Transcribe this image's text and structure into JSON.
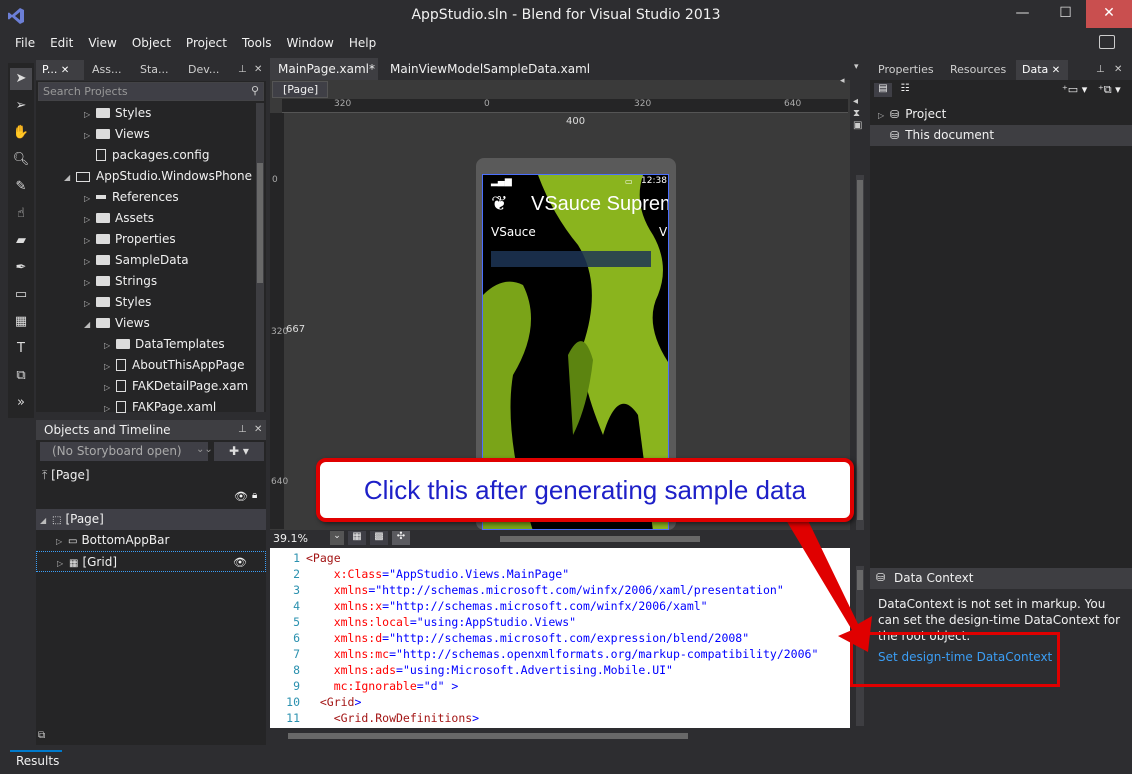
{
  "window": {
    "title": "AppStudio.sln - Blend for Visual Studio 2013",
    "minimize": "—",
    "maximize": "☐",
    "close": "✕"
  },
  "menu": [
    "File",
    "Edit",
    "View",
    "Object",
    "Project",
    "Tools",
    "Window",
    "Help"
  ],
  "tools": [
    "selection-icon",
    "direct-selection-icon",
    "pan-icon",
    "zoom-icon",
    "eyedropper-icon",
    "paint-bucket-icon",
    "eraser-icon",
    "pen-icon",
    "rectangle-icon",
    "grid-icon",
    "text-icon",
    "control-icon",
    "more-tools-icon"
  ],
  "project_panel": {
    "tabs": [
      "P...",
      "Ass...",
      "Sta...",
      "Dev..."
    ],
    "search_placeholder": "Search Projects",
    "tree": [
      {
        "label": "Styles",
        "indent": 1,
        "type": "folder",
        "arrow": "▷"
      },
      {
        "label": "Views",
        "indent": 1,
        "type": "folder",
        "arrow": "▷"
      },
      {
        "label": "packages.config",
        "indent": 1,
        "type": "file",
        "arrow": ""
      },
      {
        "label": "AppStudio.WindowsPhone",
        "indent": 0,
        "type": "project",
        "arrow": "◢"
      },
      {
        "label": "References",
        "indent": 1,
        "type": "ref",
        "arrow": "▷"
      },
      {
        "label": "Assets",
        "indent": 1,
        "type": "folder",
        "arrow": "▷"
      },
      {
        "label": "Properties",
        "indent": 1,
        "type": "folder",
        "arrow": "▷"
      },
      {
        "label": "SampleData",
        "indent": 1,
        "type": "folder",
        "arrow": "▷"
      },
      {
        "label": "Strings",
        "indent": 1,
        "type": "folder",
        "arrow": "▷"
      },
      {
        "label": "Styles",
        "indent": 1,
        "type": "folder",
        "arrow": "▷"
      },
      {
        "label": "Views",
        "indent": 1,
        "type": "folder",
        "arrow": "◢"
      },
      {
        "label": "DataTemplates",
        "indent": 2,
        "type": "folder",
        "arrow": "▷"
      },
      {
        "label": "AboutThisAppPage",
        "indent": 2,
        "type": "file",
        "arrow": "▷"
      },
      {
        "label": "FAKDetailPage.xam",
        "indent": 2,
        "type": "file",
        "arrow": "▷"
      },
      {
        "label": "FAKPage.xaml",
        "indent": 2,
        "type": "file",
        "arrow": "▷"
      }
    ]
  },
  "objects_panel": {
    "title": "Objects and Timeline",
    "storyboard": "(No Storyboard open)",
    "scope": "[Page]",
    "items": [
      {
        "label": "[Page]",
        "indent": 0,
        "arrow": "◢",
        "selected": true
      },
      {
        "label": "BottomAppBar",
        "indent": 1,
        "arrow": "▷",
        "selected": false
      },
      {
        "label": "[Grid]",
        "indent": 1,
        "arrow": "▷",
        "selected": false
      }
    ]
  },
  "documents": {
    "tabs": [
      "MainPage.xaml*",
      "MainViewModelSampleData.xaml"
    ],
    "breadcrumb": "[Page]",
    "ruler_top": [
      "320",
      "0",
      "320",
      "640"
    ],
    "ruler_width": "400",
    "ruler_left": [
      "0",
      "320",
      "640"
    ],
    "ruler_height": "667",
    "zoom": "39.1%"
  },
  "phone": {
    "time": "12:38",
    "app_title": "VSauce Suprem",
    "pivot_item": "VSauce",
    "pivot_next": "V"
  },
  "code": [
    {
      "n": "1",
      "parts": [
        [
          "tg",
          "<Page"
        ]
      ]
    },
    {
      "n": "2",
      "parts": [
        [
          "at",
          "    x:Class"
        ],
        [
          "br",
          "="
        ],
        [
          "vl",
          "\"AppStudio.Views.MainPage\""
        ]
      ]
    },
    {
      "n": "3",
      "parts": [
        [
          "at",
          "    xmlns"
        ],
        [
          "br",
          "="
        ],
        [
          "vl",
          "\"http://schemas.microsoft.com/winfx/2006/xaml/presentation\""
        ]
      ]
    },
    {
      "n": "4",
      "parts": [
        [
          "at",
          "    xmlns:x"
        ],
        [
          "br",
          "="
        ],
        [
          "vl",
          "\"http://schemas.microsoft.com/winfx/2006/xaml\""
        ]
      ]
    },
    {
      "n": "5",
      "parts": [
        [
          "at",
          "    xmlns:local"
        ],
        [
          "br",
          "="
        ],
        [
          "vl",
          "\"using:AppStudio.Views\""
        ]
      ]
    },
    {
      "n": "6",
      "parts": [
        [
          "at",
          "    xmlns:d"
        ],
        [
          "br",
          "="
        ],
        [
          "vl",
          "\"http://schemas.microsoft.com/expression/blend/2008\""
        ]
      ]
    },
    {
      "n": "7",
      "parts": [
        [
          "at",
          "    xmlns:mc"
        ],
        [
          "br",
          "="
        ],
        [
          "vl",
          "\"http://schemas.openxmlformats.org/markup-compatibility/2006\""
        ]
      ]
    },
    {
      "n": "8",
      "parts": [
        [
          "at",
          "    xmlns:ads"
        ],
        [
          "br",
          "="
        ],
        [
          "vl",
          "\"using:Microsoft.Advertising.Mobile.UI\""
        ]
      ]
    },
    {
      "n": "9",
      "parts": [
        [
          "at",
          "    mc:Ignorable"
        ],
        [
          "br",
          "="
        ],
        [
          "vl",
          "\"d\""
        ],
        [
          "br",
          " >"
        ]
      ]
    },
    {
      "n": "10",
      "parts": [
        [
          "tg",
          "  <Grid"
        ],
        [
          "br",
          ">"
        ]
      ]
    },
    {
      "n": "11",
      "parts": [
        [
          "tg",
          "    <Grid.RowDefinitions"
        ],
        [
          "br",
          ">"
        ]
      ]
    }
  ],
  "right_panel": {
    "tabs": [
      "Properties",
      "Resources",
      "Data"
    ],
    "tree": [
      {
        "label": "Project",
        "arrow": "▷"
      },
      {
        "label": "This document",
        "arrow": ""
      }
    ]
  },
  "data_context": {
    "title": "Data Context",
    "message": "DataContext is not set in markup. You can set the design-time DataContext for the root object.",
    "link": "Set design-time DataContext"
  },
  "status": {
    "results": "Results"
  },
  "callout": {
    "text": "Click this after generating sample data"
  },
  "colors": {
    "accent": "#007acc",
    "callout_border": "#e00000",
    "callout_text": "#1e20c8",
    "link": "#3b9ef5"
  }
}
